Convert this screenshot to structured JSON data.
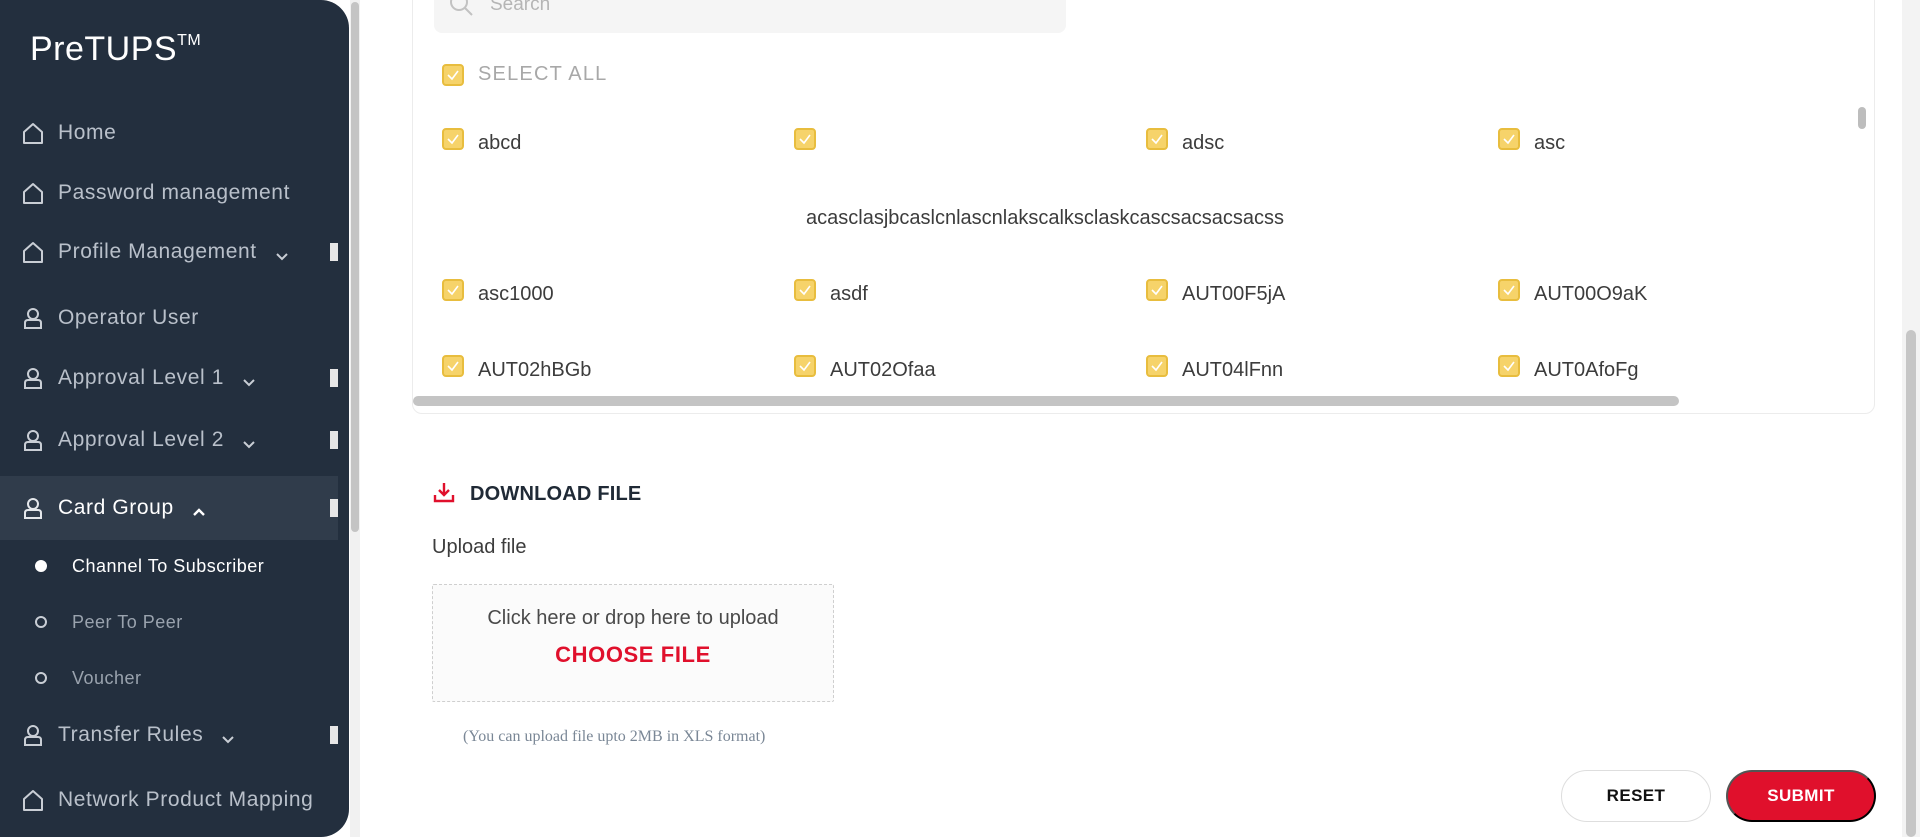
{
  "app": {
    "brand": "PreTUPS",
    "brand_tm": "TM"
  },
  "sidebar": {
    "items": [
      {
        "label": "Home",
        "icon": "home-icon"
      },
      {
        "label": "Password management",
        "icon": "home-icon"
      },
      {
        "label": "Profile Management",
        "icon": "home-icon",
        "has_chevron": true
      },
      {
        "label": "Operator User",
        "icon": "user-icon"
      },
      {
        "label": "Approval Level 1",
        "icon": "user-icon",
        "has_chevron": true
      },
      {
        "label": "Approval Level 2",
        "icon": "user-icon",
        "has_chevron": true
      },
      {
        "label": "Card Group",
        "icon": "user-icon",
        "has_chevron": true,
        "expanded": true,
        "active": true
      },
      {
        "label": "Transfer Rules",
        "icon": "user-icon",
        "has_chevron": true
      },
      {
        "label": "Network Product Mapping",
        "icon": "home-icon"
      }
    ],
    "sub_items": [
      {
        "label": "Channel To Subscriber",
        "active": true
      },
      {
        "label": "Peer To Peer",
        "active": false
      },
      {
        "label": "Voucher",
        "active": false
      }
    ]
  },
  "search": {
    "placeholder": "Search"
  },
  "select_all": {
    "label": "SELECT ALL",
    "checked": true
  },
  "options": [
    {
      "label": "abcd",
      "checked": true
    },
    {
      "label": "",
      "checked": true
    },
    {
      "label": "adsc",
      "checked": true
    },
    {
      "label": "asc",
      "checked": true
    },
    {
      "label": "asc1000",
      "checked": true
    },
    {
      "label": "asdf",
      "checked": true
    },
    {
      "label": "AUT00F5jA",
      "checked": true
    },
    {
      "label": "AUT00O9aK",
      "checked": true
    },
    {
      "label": "AUT02hBGb",
      "checked": true
    },
    {
      "label": "AUT02Ofaa",
      "checked": true
    },
    {
      "label": "AUT04lFnn",
      "checked": true
    },
    {
      "label": "AUT0AfoFg",
      "checked": true
    }
  ],
  "long_option_text": "acasclasjbcaslcnlascnlakscalksclaskcascsacsacsacss",
  "download": {
    "label": "DOWNLOAD FILE"
  },
  "upload": {
    "title": "Upload file",
    "hint": "Click here or drop here to upload",
    "choose": "CHOOSE FILE",
    "note": "(You can upload file upto 2MB in XLS format)"
  },
  "buttons": {
    "reset": "RESET",
    "submit": "SUBMIT"
  },
  "colors": {
    "sidebar_bg": "#232f3e",
    "accent_red": "#e0102c",
    "checkbox_yellow": "#f6d36a"
  }
}
